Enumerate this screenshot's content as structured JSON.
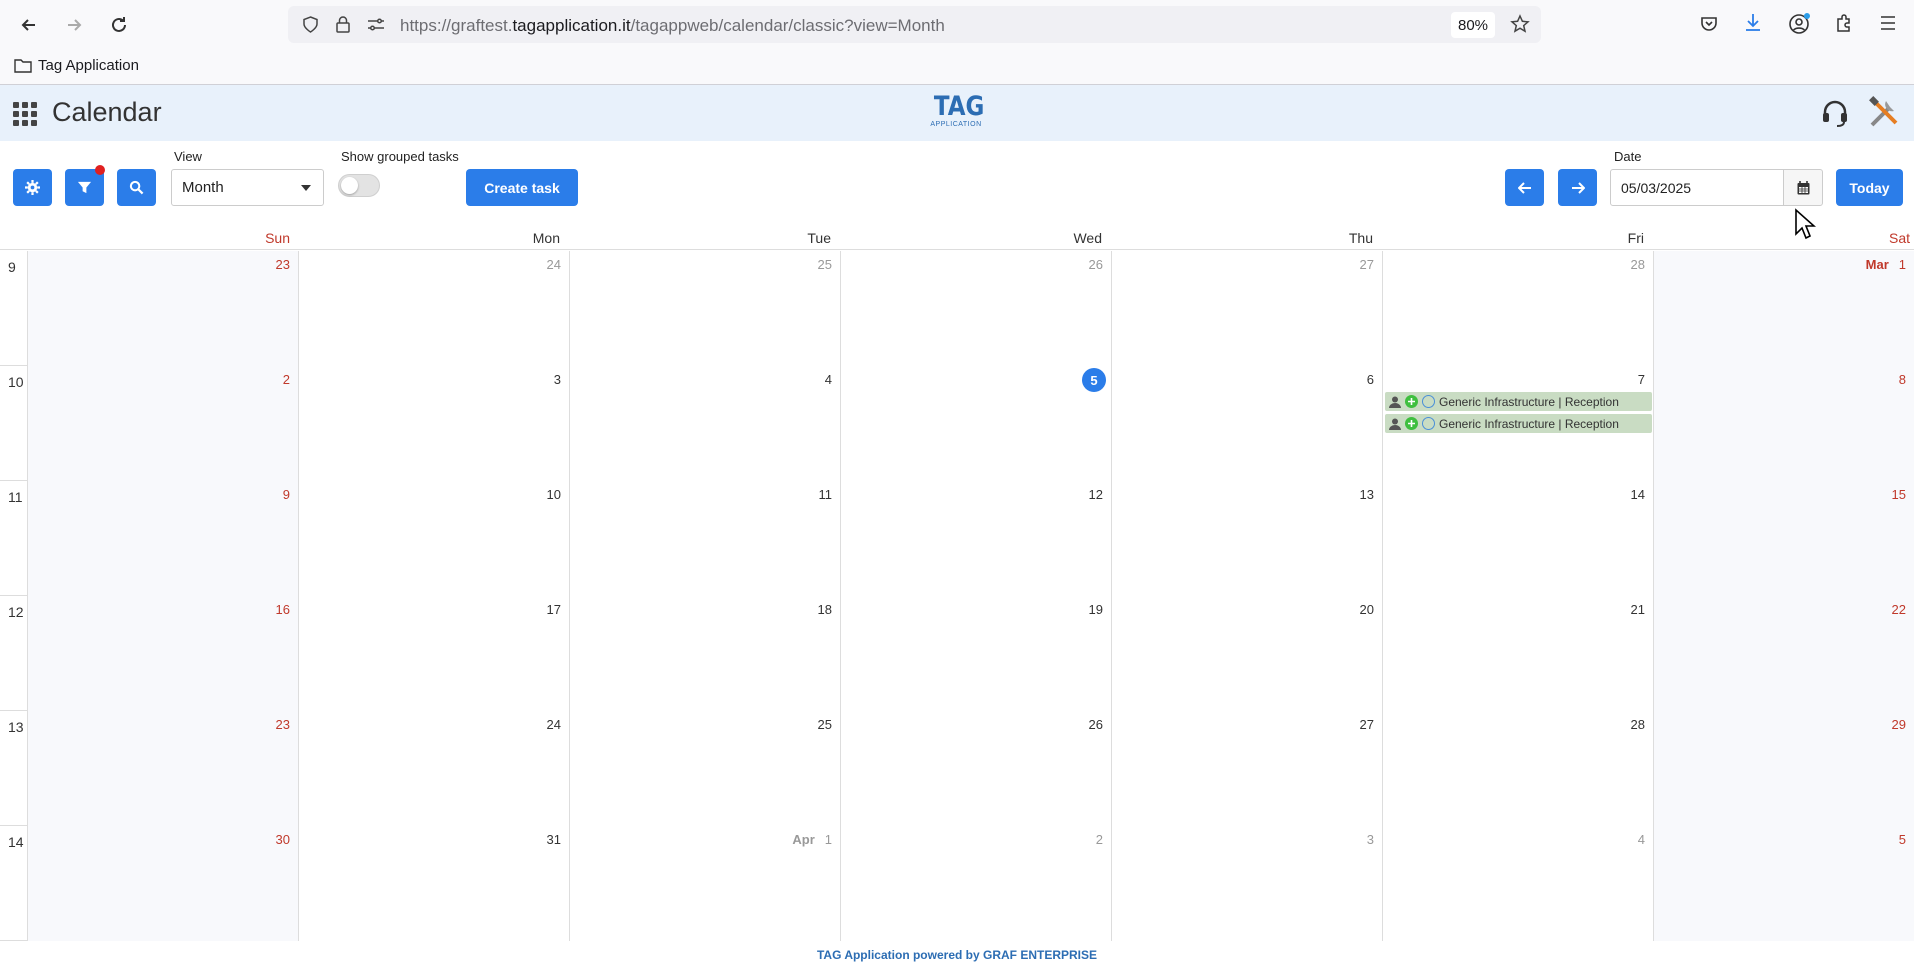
{
  "browser": {
    "url_prefix": "https://graftest.",
    "url_domain": "tagapplication.it",
    "url_path": "/tagappweb/calendar/classic?view=Month",
    "zoom": "80%",
    "bookmark": "Tag Application"
  },
  "header": {
    "title": "Calendar",
    "logo_main": "TAG",
    "logo_sub": "APPLICATION"
  },
  "toolbar": {
    "view_label": "View",
    "view_value": "Month",
    "grouped_label": "Show grouped tasks",
    "create_task": "Create task",
    "date_label": "Date",
    "date_value": "05/03/2025",
    "today": "Today"
  },
  "calendar": {
    "days_of_week": [
      "Sun",
      "Mon",
      "Tue",
      "Wed",
      "Thu",
      "Fri",
      "Sat"
    ],
    "weeks": [
      {
        "num": "9",
        "days": [
          "23",
          "24",
          "25",
          "26",
          "27",
          "28",
          "1"
        ]
      },
      {
        "num": "10",
        "days": [
          "2",
          "3",
          "4",
          "5",
          "6",
          "7",
          "8"
        ]
      },
      {
        "num": "11",
        "days": [
          "9",
          "10",
          "11",
          "12",
          "13",
          "14",
          "15"
        ]
      },
      {
        "num": "12",
        "days": [
          "16",
          "17",
          "18",
          "19",
          "20",
          "21",
          "22"
        ]
      },
      {
        "num": "13",
        "days": [
          "23",
          "24",
          "25",
          "26",
          "27",
          "28",
          "29"
        ]
      },
      {
        "num": "14",
        "days": [
          "30",
          "31",
          "1",
          "2",
          "3",
          "4",
          "5"
        ]
      }
    ],
    "month_label_mar": "Mar",
    "month_label_apr": "Apr",
    "events": [
      {
        "title": "Generic Infrastructure | Reception"
      },
      {
        "title": "Generic Infrastructure | Reception"
      }
    ]
  },
  "footer": "TAG Application powered by GRAF ENTERPRISE"
}
